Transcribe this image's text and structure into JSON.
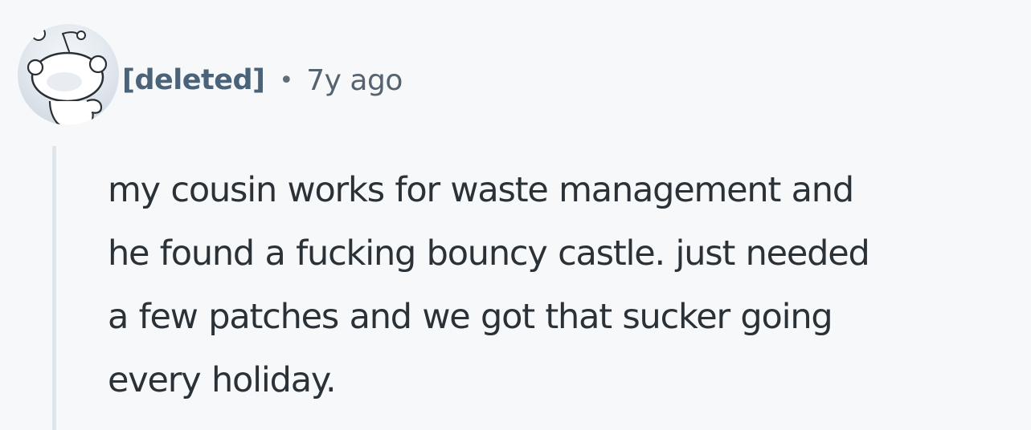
{
  "comment": {
    "author": "[deleted]",
    "separator": "•",
    "age": "7y ago",
    "avatar_icon": "snoo-deleted-avatar-icon",
    "body_lines": [
      "my cousin works for waste management and",
      "he found a fucking bouncy castle. just needed",
      "a few patches and we got that sucker going",
      "every holiday."
    ]
  },
  "colors": {
    "background": "#f6f8fa",
    "author": "#4b6379",
    "meta": "#56636e",
    "body": "#2a3137",
    "thread_line": "#dfe5ec"
  }
}
